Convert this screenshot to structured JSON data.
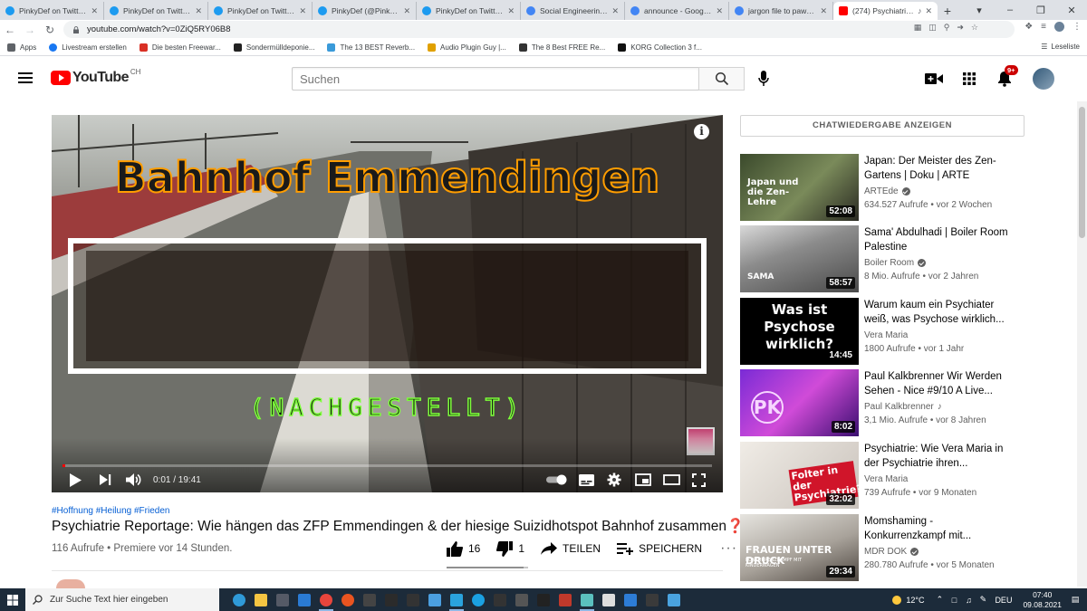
{
  "browser": {
    "tabs": [
      {
        "title": "PinkyDef on Twitter: \"\"",
        "icon": "twitter-icon",
        "active": false
      },
      {
        "title": "PinkyDef on Twitter: \"\"",
        "icon": "twitter-icon",
        "active": false
      },
      {
        "title": "PinkyDef on Twitter: \"\"",
        "icon": "twitter-icon",
        "active": false
      },
      {
        "title": "PinkyDef (@PinkyDef)",
        "icon": "twitter-icon",
        "active": false
      },
      {
        "title": "PinkyDef on Twitter: \"\"",
        "icon": "twitter-icon",
        "active": false
      },
      {
        "title": "Social Engineering - G",
        "icon": "google-icon",
        "active": false
      },
      {
        "title": "announce - Google Su",
        "icon": "google-icon",
        "active": false
      },
      {
        "title": "jargon file to pawn ha",
        "icon": "google-icon",
        "active": false
      },
      {
        "title": "(274) Psychiatrie R",
        "icon": "youtube-icon",
        "active": true
      }
    ],
    "url": "youtube.com/watch?v=0ZiQ5RY06B8",
    "bookmarks": [
      {
        "label": "Apps",
        "icon": "apps-grid-icon",
        "color": "#5f6368"
      },
      {
        "label": "Livestream erstellen",
        "icon": "facebook-icon",
        "color": "#1877f2"
      },
      {
        "label": "Die besten Freewar...",
        "icon": "star-icon",
        "color": "#d93025"
      },
      {
        "label": "Sondermülldeponie...",
        "icon": "w-icon",
        "color": "#222222"
      },
      {
        "label": "The 13 BEST Reverb...",
        "icon": "plugin-icon",
        "color": "#3a9ad9"
      },
      {
        "label": "Audio Plugin Guy |...",
        "icon": "plugin-guy-icon",
        "color": "#e0a000"
      },
      {
        "label": "The 8 Best FREE Re...",
        "icon": "moon-icon",
        "color": "#333333"
      },
      {
        "label": "KORG Collection 3 f...",
        "icon": "korg-icon",
        "color": "#111111"
      }
    ],
    "reading_list": "Leseliste"
  },
  "masthead": {
    "logo_text": "YouTube",
    "country_code": "CH",
    "search_placeholder": "Suchen",
    "notification_count": "9+"
  },
  "player": {
    "overlay_title": "Bahnhof Emmendingen",
    "overlay_subtitle": "(NACHGESTELLT)",
    "current_time": "0:01",
    "duration": "19:41",
    "time_display": "0:01 / 19:41",
    "progress_fraction": 0.001
  },
  "video": {
    "hashtags": "#Hoffnung #Heilung #Frieden",
    "title": "Psychiatrie Reportage: Wie hängen das ZFP Emmendingen & der hiesige Suizidhotspot Bahnhof zusammen❓❔",
    "meta": "116 Aufrufe • Premiere vor 14 Stunden.",
    "likes": "16",
    "dislikes": "1",
    "share_label": "TEILEN",
    "save_label": "SPEICHERN",
    "like_fraction": 0.94
  },
  "sidebar": {
    "chat_button": "CHATWIEDERGABE ANZEIGEN",
    "recommendations": [
      {
        "title": "Japan: Der Meister des Zen-Gartens | Doku | ARTE",
        "channel": "ARTEde",
        "verified": true,
        "meta": "634.527 Aufrufe • vor 2 Wochen",
        "duration": "52:08",
        "thumb_text": "Japan und die Zen-Lehre"
      },
      {
        "title": "Sama' Abdulhadi | Boiler Room Palestine",
        "channel": "Boiler Room",
        "verified": true,
        "meta": "8 Mio. Aufrufe • vor 2 Jahren",
        "duration": "58:57",
        "thumb_text": "SAMA"
      },
      {
        "title": "Warum kaum ein Psychiater weiß, was Psychose wirklich...",
        "channel": "Vera Maria",
        "verified": false,
        "meta": "1800 Aufrufe • vor 1 Jahr",
        "duration": "14:45",
        "thumb_text": "Was ist Psychose wirklich?"
      },
      {
        "title": "Paul Kalkbrenner Wir Werden Sehen - Nice #9/10 A Live...",
        "channel": "Paul Kalkbrenner",
        "verified": false,
        "music": true,
        "meta": "3,1 Mio. Aufrufe • vor 8 Jahren",
        "duration": "8:02",
        "thumb_text": "PK"
      },
      {
        "title": "Psychiatrie: Wie Vera Maria in der Psychiatrie ihren...",
        "channel": "Vera Maria",
        "verified": false,
        "meta": "739 Aufrufe • vor 9 Monaten",
        "duration": "32:02",
        "thumb_text": "Folter in der Psychiatrie?"
      },
      {
        "title": "Momshaming - Konkurrenzkampf mit...",
        "channel": "MDR DOK",
        "verified": true,
        "meta": "280.780 Aufrufe • vor 5 Monaten",
        "duration": "29:34",
        "thumb_text": "FRAUEN UNTER DRUCK",
        "thumb_subtext": "KONKURRENZKAMPF MIT KINDERWAGEN"
      }
    ]
  },
  "taskbar": {
    "search_placeholder": "Zur Suche Text hier eingeben",
    "temperature": "12°C",
    "language": "DEU",
    "time": "07:40",
    "date": "09.08.2021"
  }
}
